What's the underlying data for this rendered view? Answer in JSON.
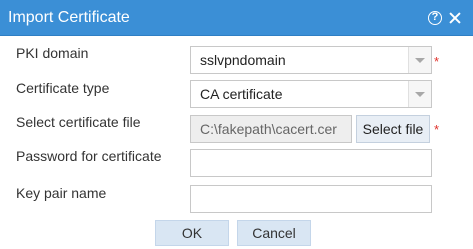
{
  "dialog": {
    "title": "Import Certificate",
    "help_icon": "help-icon",
    "close_icon": "close-icon",
    "header_color": "#3b8fd6"
  },
  "form": {
    "pki_domain": {
      "label": "PKI domain",
      "value": "sslvpndomain",
      "required_mark": "*"
    },
    "certificate_type": {
      "label": "Certificate type",
      "value": "CA certificate"
    },
    "certificate_file": {
      "label": "Select certificate file",
      "value": "C:\\fakepath\\cacert.cer",
      "button_label": "Select file",
      "required_mark": "*"
    },
    "password": {
      "label": "Password for certificate",
      "value": ""
    },
    "key_pair_name": {
      "label": "Key pair name",
      "value": ""
    }
  },
  "buttons": {
    "ok_label": "OK",
    "cancel_label": "Cancel"
  }
}
